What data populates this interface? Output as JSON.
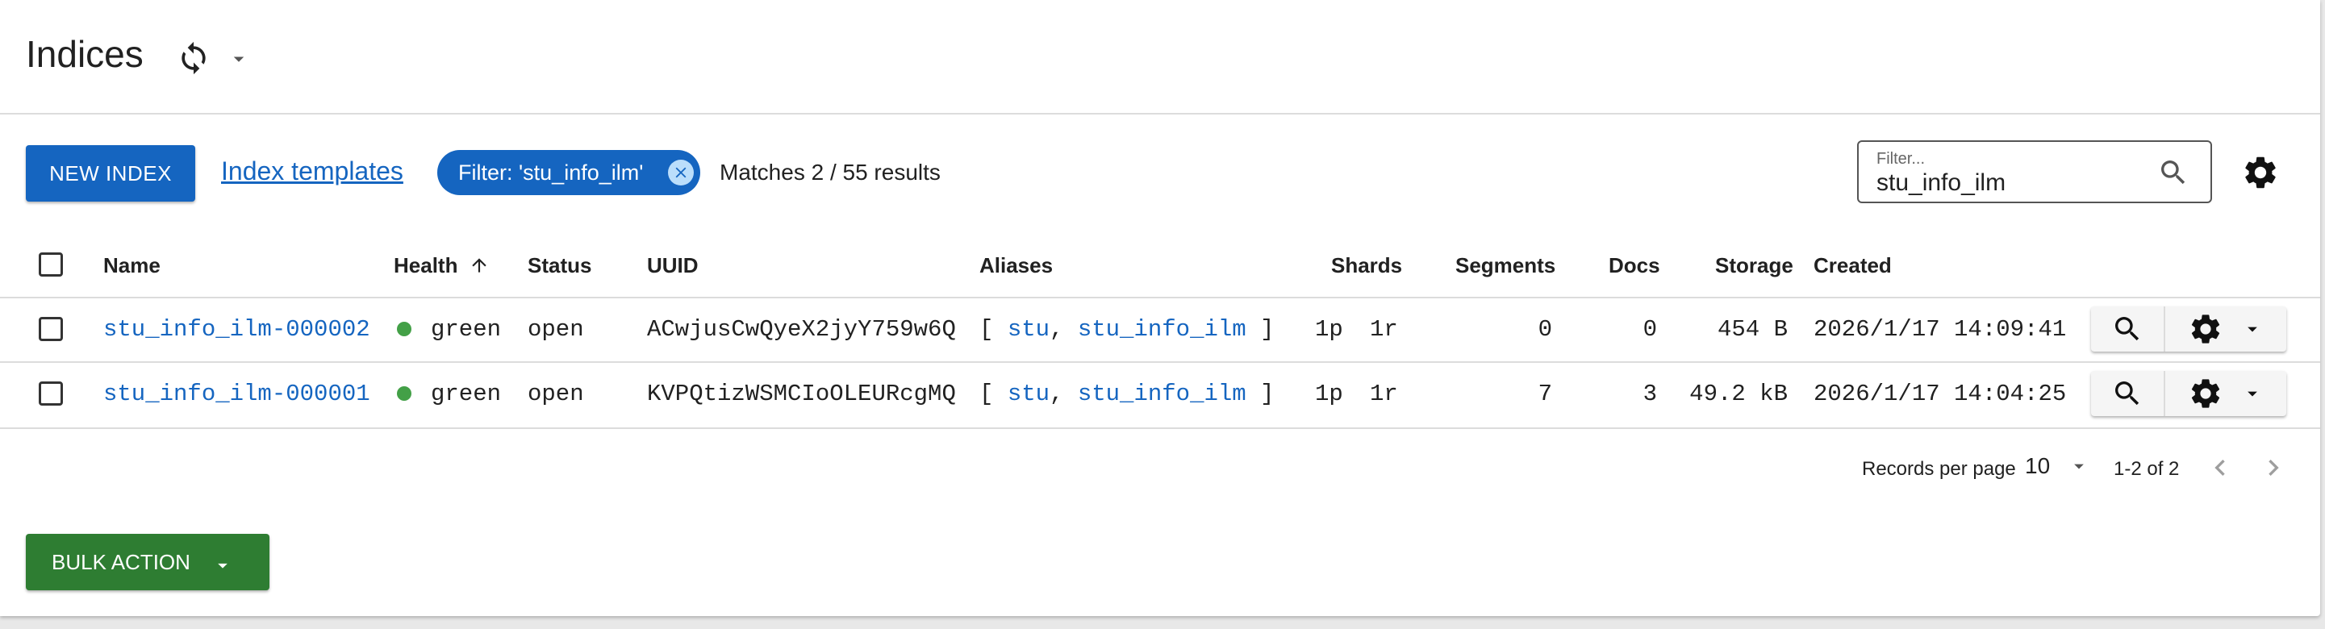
{
  "header": {
    "title": "Indices"
  },
  "toolbar": {
    "new_index_label": "NEW INDEX",
    "templates_link": "Index templates",
    "filter_chip": "Filter: 'stu_info_ilm'",
    "matches": "Matches 2 / 55 results",
    "filter_label": "Filter...",
    "filter_value": "stu_info_ilm"
  },
  "table": {
    "columns": {
      "name": "Name",
      "health": "Health",
      "status": "Status",
      "uuid": "UUID",
      "aliases": "Aliases",
      "shards": "Shards",
      "segments": "Segments",
      "docs": "Docs",
      "storage": "Storage",
      "created": "Created"
    },
    "rows": [
      {
        "name": "stu_info_ilm-000002",
        "health": "green",
        "status": "open",
        "uuid": "ACwjusCwQyeX2jyY759w6Q",
        "alias_open": "[",
        "alias1": "stu",
        "alias_sep": ",",
        "alias2": "stu_info_ilm",
        "alias_close": "]",
        "primary": "1p",
        "replica": "1r",
        "segments": "0",
        "docs": "0",
        "storage": "454 B",
        "created": "2026/1/17 14:09:41"
      },
      {
        "name": "stu_info_ilm-000001",
        "health": "green",
        "status": "open",
        "uuid": "KVPQtizWSMCIoOLEURcgMQ",
        "alias_open": "[",
        "alias1": "stu",
        "alias_sep": ",",
        "alias2": "stu_info_ilm",
        "alias_close": "]",
        "primary": "1p",
        "replica": "1r",
        "segments": "7",
        "docs": "3",
        "storage": "49.2 kB",
        "created": "2026/1/17 14:04:25"
      }
    ]
  },
  "pagination": {
    "label": "Records per page",
    "per_page": "10",
    "range": "1-2 of 2"
  },
  "footer": {
    "bulk_action_label": "BULK ACTION"
  },
  "colors": {
    "primary": "#1565c0",
    "success": "#2e7d32",
    "health_green": "#43a047"
  }
}
